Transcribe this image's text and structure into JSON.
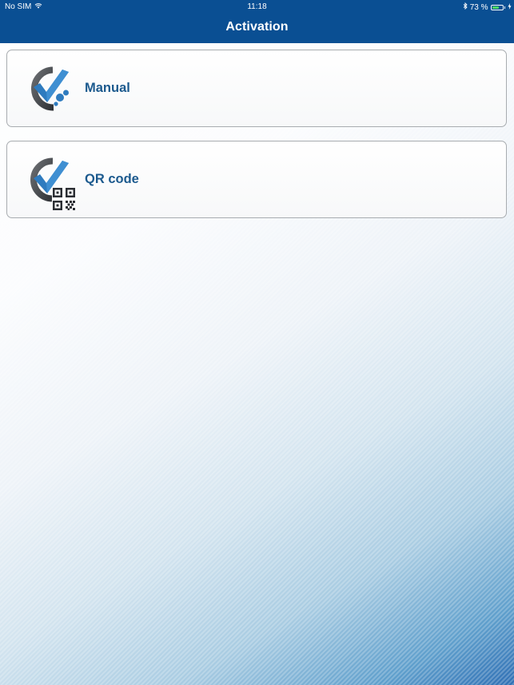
{
  "status_bar": {
    "carrier": "No SIM",
    "time": "11:18",
    "battery_text": "73 %",
    "battery_level": 0.73
  },
  "header": {
    "title": "Activation"
  },
  "options": [
    {
      "label": "Manual",
      "icon": "manual-check-icon"
    },
    {
      "label": "QR code",
      "icon": "qr-check-icon"
    }
  ],
  "colors": {
    "header_bg": "#0a4f93",
    "label_text": "#1c5a8e",
    "check_blue": "#2e7bbf",
    "ring_gray": "#4a4d52"
  }
}
